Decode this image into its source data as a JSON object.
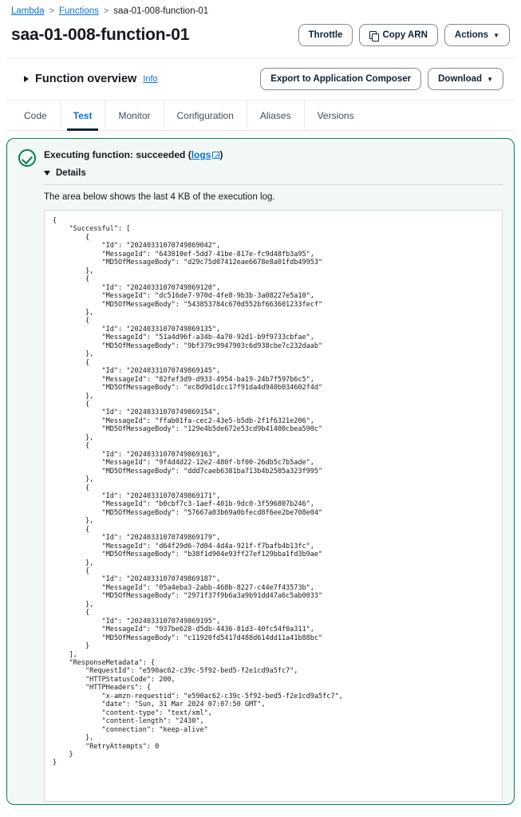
{
  "breadcrumb": {
    "items": [
      {
        "label": "Lambda",
        "link": true
      },
      {
        "label": "Functions",
        "link": true
      },
      {
        "label": "saa-01-008-function-01",
        "link": false
      }
    ],
    "separator": ">"
  },
  "header": {
    "title": "saa-01-008-function-01",
    "buttons": {
      "throttle": "Throttle",
      "copy_arn": "Copy ARN",
      "actions": "Actions",
      "caret": "▼"
    }
  },
  "function_overview": {
    "title": "Function overview",
    "info": "Info",
    "export_button": "Export to Application Composer",
    "download_button": "Download",
    "caret": "▼"
  },
  "tabs": [
    {
      "label": "Code",
      "active": false
    },
    {
      "label": "Test",
      "active": true
    },
    {
      "label": "Monitor",
      "active": false
    },
    {
      "label": "Configuration",
      "active": false
    },
    {
      "label": "Aliases",
      "active": false
    },
    {
      "label": "Versions",
      "active": false
    }
  ],
  "result": {
    "status_text": "Executing function: succeeded (",
    "logs_label": "logs",
    "status_suffix": ")",
    "details_label": "Details",
    "log_note": "The area below shows the last 4 KB of the execution log.",
    "accent_color": "#037f51",
    "panel_background": "#f2f8f5"
  },
  "log_output": "{\n    \"Successful\": [\n        {\n            \"Id\": \"20240331070749869042\",\n            \"MessageId\": \"643010ef-5dd7-41be-817e-fc9d48fb3a95\",\n            \"MD5OfMessageBody\": \"d29c75d07412eae6678e8a01fdb49953\"\n        },\n        {\n            \"Id\": \"20240331070749869120\",\n            \"MessageId\": \"dc516de7-970d-4fe8-9b3b-3a08227e5a10\",\n            \"MD5OfMessageBody\": \"543853784c670d552bf663601233fecf\"\n        },\n        {\n            \"Id\": \"20240331070749869135\",\n            \"MessageId\": \"51a4d96f-a34b-4a70-92d1-b9f9733cbfae\",\n            \"MD5OfMessageBody\": \"9bf379c9947903c6d938cbe7c232daab\"\n        },\n        {\n            \"Id\": \"20240331070749869145\",\n            \"MessageId\": \"82fef3d9-d933-4954-ba19-24b7f597b6c5\",\n            \"MD5OfMessageBody\": \"ec8d9d1dcc17f91da4d940b034602f4d\"\n        },\n        {\n            \"Id\": \"20240331070749869154\",\n            \"MessageId\": \"ffab01fa-cec2-43e5-b5db-2f1f6321e206\",\n            \"MD5OfMessageBody\": \"129e4b5de672e53cd9b41400cbea590c\"\n        },\n        {\n            \"Id\": \"20240331070749869163\",\n            \"MessageId\": \"9f4d4d22-12e2-480f-bf00-26db5c7b5ade\",\n            \"MD5OfMessageBody\": \"ddd7caeb6381ba713b4b2505a323f995\"\n        },\n        {\n            \"Id\": \"20240331070749869171\",\n            \"MessageId\": \"b0cbf7c3-1aef-401b-9dc0-3f596807b246\",\n            \"MD5OfMessageBody\": \"57667a03b69a0bfecd8f6ee2be708e04\"\n        },\n        {\n            \"Id\": \"20240331070749869179\",\n            \"MessageId\": \"d64f29d6-7d04-4d4a-921f-f7bafb4b13fc\",\n            \"MD5OfMessageBody\": \"b38f1d904e93ff27ef129bba1fd3b9ae\"\n        },\n        {\n            \"Id\": \"20240331070749869187\",\n            \"MessageId\": \"05a4eba3-2abb-468b-8227-c44e7f43573b\",\n            \"MD5OfMessageBody\": \"2971f37f9b6a3a9b91dd47a6c5ab0033\"\n        },\n        {\n            \"Id\": \"20240331070749869195\",\n            \"MessageId\": \"937be628-d5db-4436-81d3-40fc54f0a311\",\n            \"MD5OfMessageBody\": \"c11920fd5417d488d614dd11a41b88bc\"\n        }\n    ],\n    \"ResponseMetadata\": {\n        \"RequestId\": \"e590ac62-c39c-5f92-bed5-f2e1cd9a5fc7\",\n        \"HTTPStatusCode\": 200,\n        \"HTTPHeaders\": {\n            \"x-amzn-requestid\": \"e590ac62-c39c-5f92-bed5-f2e1cd9a5fc7\",\n            \"date\": \"Sun, 31 Mar 2024 07:07:50 GMT\",\n            \"content-type\": \"text/xml\",\n            \"content-length\": \"2430\",\n            \"connection\": \"keep-alive\"\n        },\n        \"RetryAttempts\": 0\n    }\n}"
}
